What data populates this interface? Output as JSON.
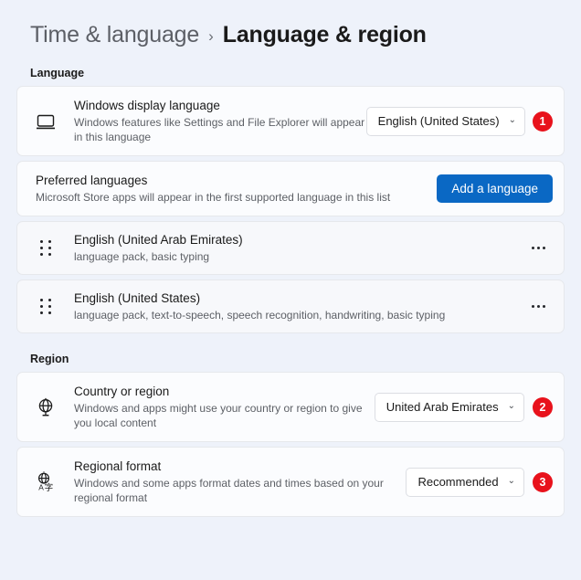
{
  "breadcrumb": {
    "parent": "Time & language",
    "separator": "›",
    "current": "Language & region"
  },
  "sections": {
    "language_label": "Language",
    "region_label": "Region"
  },
  "display_language": {
    "icon": "monitor-icon",
    "title": "Windows display language",
    "subtitle": "Windows features like Settings and File Explorer will appear in this language",
    "dropdown_value": "English (United States)",
    "chevron": "⌄",
    "badge": "1"
  },
  "preferred_languages": {
    "title": "Preferred languages",
    "subtitle": "Microsoft Store apps will appear in the first supported language in this list",
    "add_button": "Add a language"
  },
  "language_list": [
    {
      "name": "English (United Arab Emirates)",
      "features": "language pack, basic typing",
      "menu": "···"
    },
    {
      "name": "English (United States)",
      "features": "language pack, text-to-speech, speech recognition, handwriting, basic typing",
      "menu": "···"
    }
  ],
  "country_or_region": {
    "icon": "globe-icon",
    "title": "Country or region",
    "subtitle": "Windows and apps might use your country or region to give you local content",
    "dropdown_value": "United Arab Emirates",
    "chevron": "⌄",
    "badge": "2"
  },
  "regional_format": {
    "icon": "translate-icon",
    "title": "Regional format",
    "subtitle": "Windows and some apps format dates and times based on your regional format",
    "dropdown_value": "Recommended",
    "chevron": "⌄",
    "badge": "3"
  },
  "colors": {
    "background": "#eef2fa",
    "accent_blue": "#0a68c4",
    "badge_red": "#e8121c",
    "card": "#fbfcfe"
  }
}
